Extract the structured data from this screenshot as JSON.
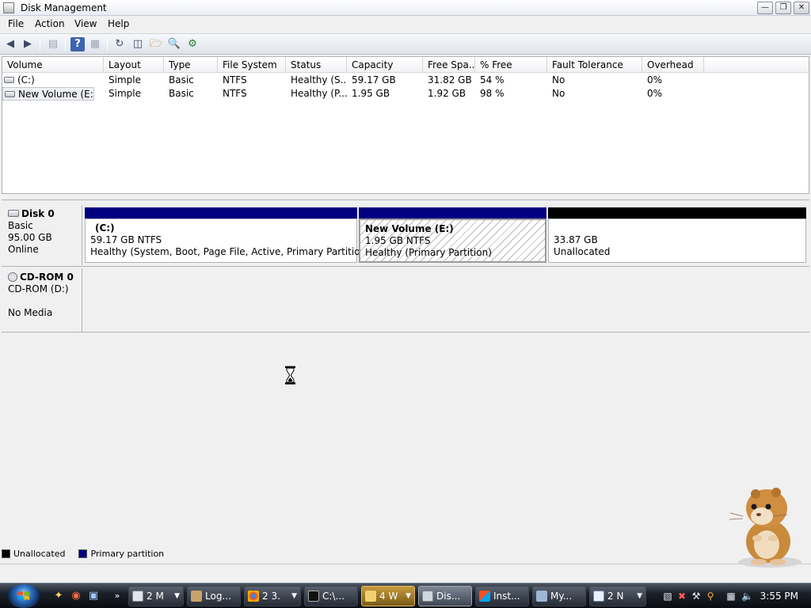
{
  "window": {
    "title": "Disk Management"
  },
  "menu": [
    "File",
    "Action",
    "View",
    "Help"
  ],
  "toolbar_icons": [
    "back-arrow-icon",
    "forward-arrow-icon",
    "show-hide-console-tree-icon",
    "help-icon",
    "properties-icon",
    "refresh-icon",
    "export-list-icon",
    "open-folder-icon",
    "search-icon",
    "settings-icon"
  ],
  "volume_table": {
    "columns": [
      "Volume",
      "Layout",
      "Type",
      "File System",
      "Status",
      "Capacity",
      "Free Spa...",
      "% Free",
      "Fault Tolerance",
      "Overhead"
    ],
    "rows": [
      [
        "(C:)",
        "Simple",
        "Basic",
        "NTFS",
        "Healthy (S...",
        "59.17 GB",
        "31.82 GB",
        "54 %",
        "No",
        "0%"
      ],
      [
        "New Volume (E:)",
        "Simple",
        "Basic",
        "NTFS",
        "Healthy (P...",
        "1.95 GB",
        "1.92 GB",
        "98 %",
        "No",
        "0%"
      ]
    ]
  },
  "disks": [
    {
      "name": "Disk 0",
      "type": "Basic",
      "size": "95.00 GB",
      "status": "Online",
      "partitions": [
        {
          "title": "(C:)",
          "size": "59.17 GB NTFS",
          "status": "Healthy (System, Boot, Page File, Active, Primary Partition)",
          "bar_color": "#000080"
        },
        {
          "title": "New Volume  (E:)",
          "size": "1.95 GB NTFS",
          "status": "Healthy (Primary Partition)",
          "bar_color": "#000080",
          "selected": true
        },
        {
          "title": "",
          "size": "33.87 GB",
          "status": "Unallocated",
          "bar_color": "#000000"
        }
      ]
    },
    {
      "name": "CD-ROM 0",
      "type": "CD-ROM (D:)",
      "size": "",
      "status": "No Media"
    }
  ],
  "legend": [
    {
      "label": "Unallocated",
      "color": "#000000"
    },
    {
      "label": "Primary partition",
      "color": "#000080"
    }
  ],
  "taskbar": {
    "buttons": [
      "2 M",
      "Log...",
      "2 3.",
      "C:\\...",
      "4 W",
      "Dis...",
      "Inst...",
      "My...",
      "2 N"
    ],
    "clock": "3:55 PM"
  }
}
